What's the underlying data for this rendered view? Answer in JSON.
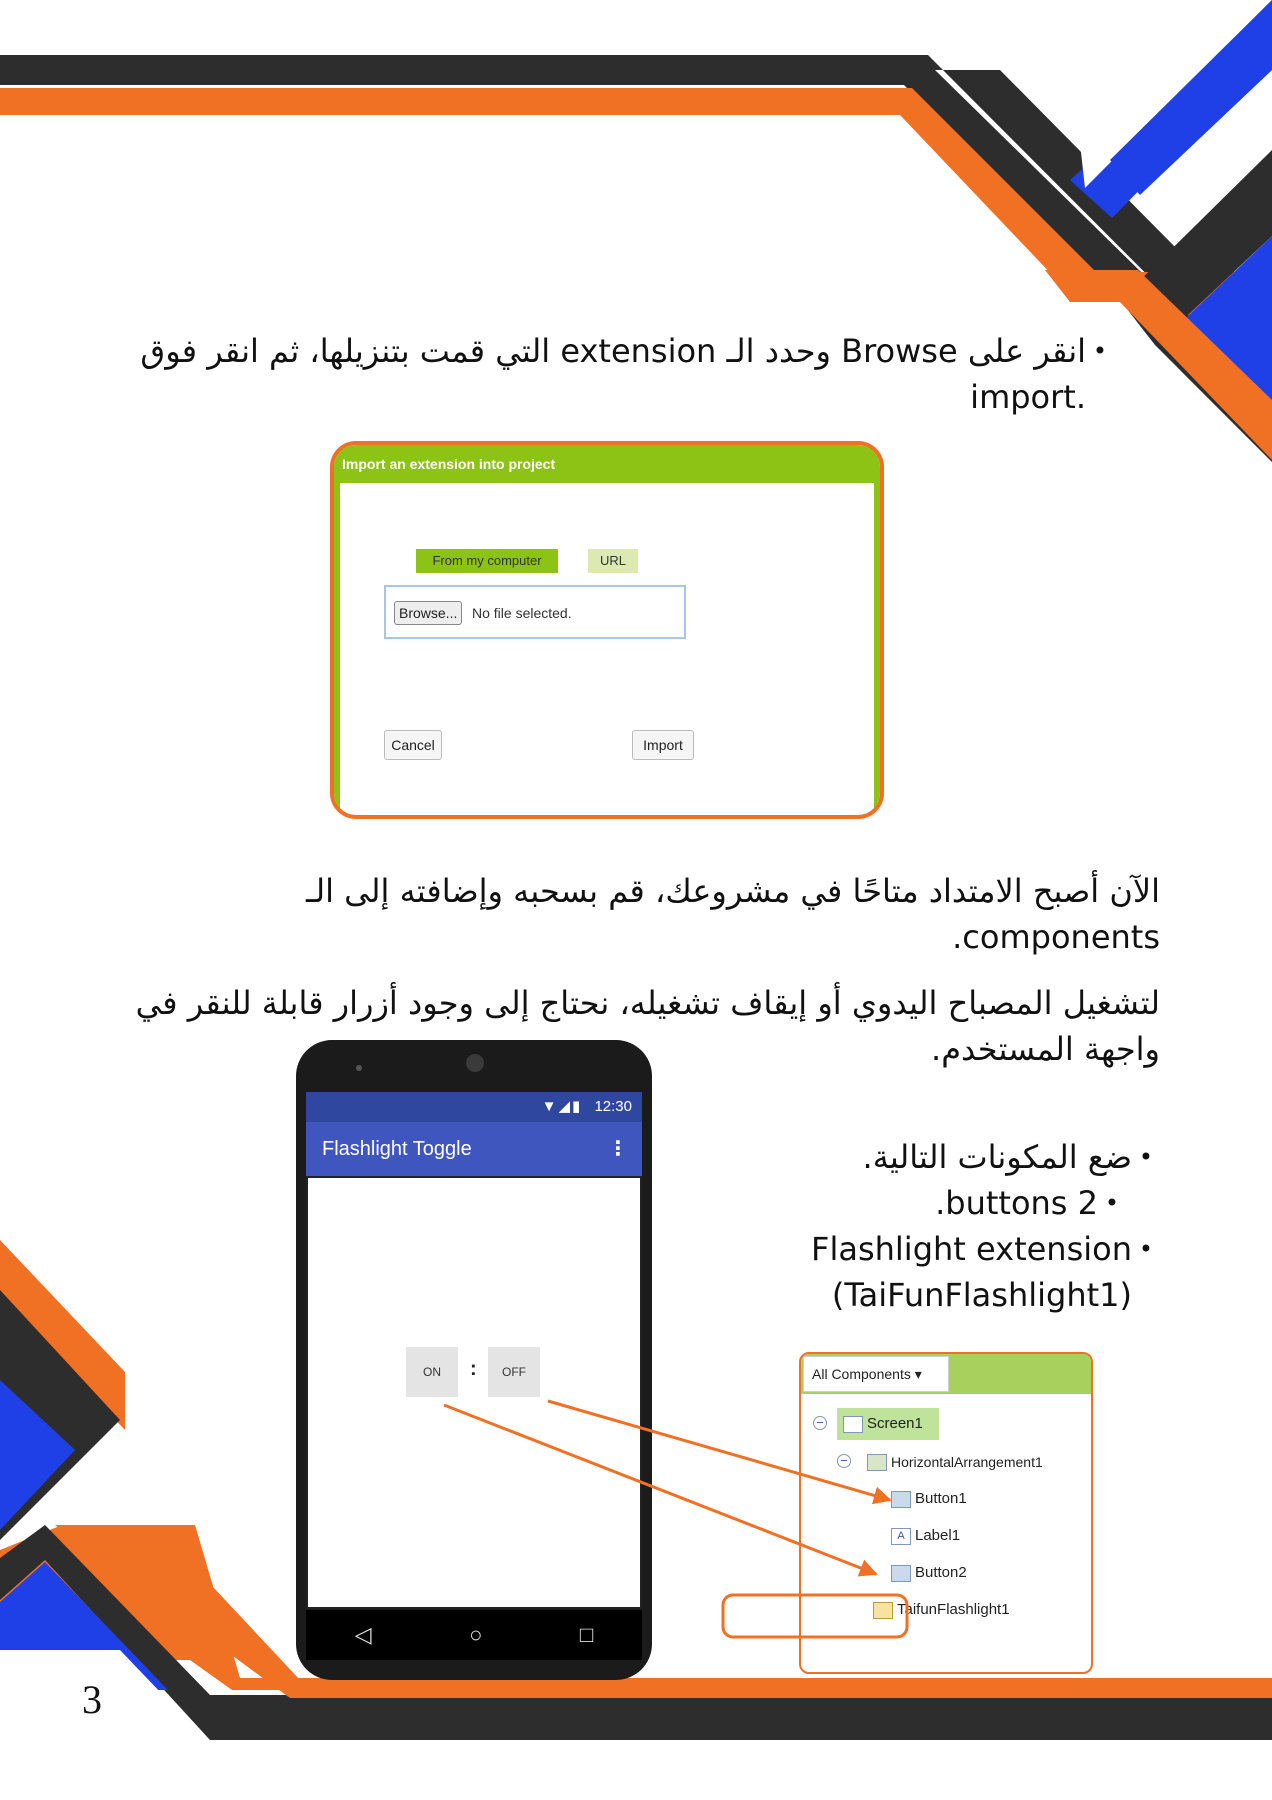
{
  "colors": {
    "accent_orange": "#f07024",
    "dark_stripe": "#2d2d2d",
    "accent_blue": "#1f40e6",
    "dialog_green": "#8cc314",
    "phone_blue": "#3e56bd"
  },
  "paragraphs": {
    "bullet1": "انقر على Browse وحدد الـ extension التي قمت بتنزيلها، ثم انقر فوق .import",
    "para1": "الآن أصبح الامتداد متاحًا في مشروعك، قم بسحبه وإضافته إلى الـ components.",
    "para2": "لتشغيل المصباح اليدوي أو إيقاف تشغيله، نحتاج إلى وجود أزرار قابلة للنقر في واجهة المستخدم."
  },
  "components_list": {
    "intro": "ضع المكونات التالية.",
    "item1": ".buttons 2",
    "item2_line1": "Flashlight extension",
    "item2_line2": "(TaiFunFlashlight1)"
  },
  "dialog": {
    "title": "Import an extension into project",
    "tab_computer": "From my computer",
    "tab_url": "URL",
    "browse": "Browse...",
    "file_status": "No file selected.",
    "cancel": "Cancel",
    "import": "Import"
  },
  "phone": {
    "time": "12:30",
    "app_title": "Flashlight Toggle",
    "menu_icon": "⋮",
    "button_on": "ON",
    "label_colon": ":",
    "button_off": "OFF",
    "nav_back": "◁",
    "nav_home": "○",
    "nav_recent": "□"
  },
  "tree": {
    "dropdown": "All Components ▾",
    "screen1": "Screen1",
    "arrangement": "HorizontalArrangement1",
    "button1": "Button1",
    "label1": "Label1",
    "button2": "Button2",
    "flashlight": "TaifunFlashlight1"
  },
  "page_number": "3"
}
